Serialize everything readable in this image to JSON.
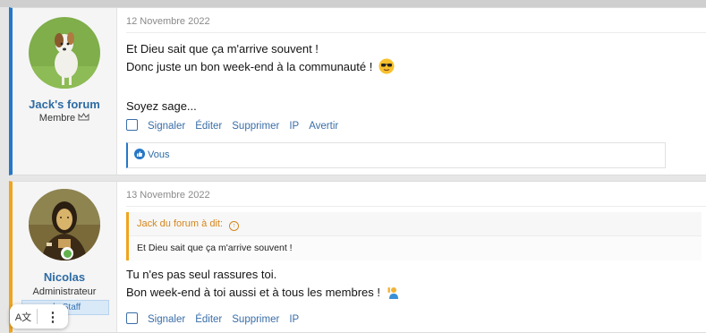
{
  "posts": [
    {
      "user": {
        "name": "Jack's forum",
        "title": "Membre"
      },
      "date": "12 Novembre 2022",
      "lines": [
        "Et Dieu sait que ça m'arrive souvent !",
        "Donc juste un bon week-end à la communauté !",
        "",
        "Soyez sage..."
      ],
      "actions": [
        "Signaler",
        "Éditer",
        "Supprimer",
        "IP",
        "Avertir"
      ],
      "reactions": {
        "label": "Vous"
      }
    },
    {
      "user": {
        "name": "Nicolas",
        "title": "Administrateur",
        "banner": "du Staff"
      },
      "date": "13 Novembre 2022",
      "quote": {
        "author": "Jack du forum à dit:",
        "text": "Et Dieu sait que ça m'arrive souvent !"
      },
      "lines": [
        "Tu n'es pas seul rassures toi.",
        "Bon week-end à toi aussi et à tous les membres !"
      ],
      "actions": [
        "Signaler",
        "Éditer",
        "Supprimer",
        "IP"
      ]
    }
  ],
  "overlay": {
    "translate": "A文",
    "more": "⋮"
  },
  "colors": {
    "post1_accent": "#2577c8",
    "post2_accent": "#f0a41e",
    "link": "#3a6ea8"
  }
}
